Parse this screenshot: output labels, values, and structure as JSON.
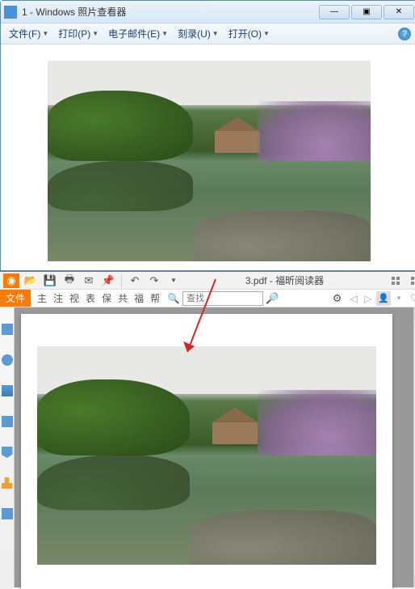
{
  "window1": {
    "title": "1 - Windows 照片查看器",
    "menu": {
      "file": "文件(F)",
      "print": "打印(P)",
      "email": "电子邮件(E)",
      "burn": "刻录(U)",
      "open": "打开(O)"
    },
    "controls": {
      "min": "—",
      "max": "▣",
      "close": "✕"
    }
  },
  "window2": {
    "toolbar": {
      "doc_title": "3.pdf - 福昕阅读器"
    },
    "file_tab": "文件",
    "ribbon": {
      "t1": "主",
      "t2": "注",
      "t3": "视",
      "t4": "表",
      "t5": "保",
      "t6": "共",
      "t7": "福",
      "t8": "帮"
    },
    "search": {
      "placeholder": "查找"
    },
    "gear": "⚙",
    "heart": "♡"
  }
}
